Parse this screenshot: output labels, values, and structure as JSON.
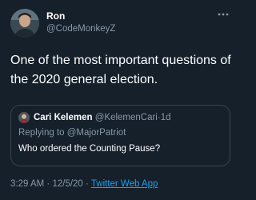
{
  "author": {
    "name": "Ron",
    "handle": "@CodeMonkeyZ"
  },
  "tweet": {
    "text": "One of the most important questions of the 2020 general election."
  },
  "quoted": {
    "name": "Cari Kelemen",
    "handle": "@KelemenCari",
    "separator": "·",
    "time": "1d",
    "reply_prefix": "Replying to ",
    "reply_to": "@MajorPatriot",
    "text": "Who ordered the Counting Pause?"
  },
  "meta": {
    "time": "3:29 AM",
    "separator": "·",
    "date": "12/5/20",
    "app": "Twitter Web App"
  },
  "colors": {
    "background": "#15202b",
    "primary_text": "#ffffff",
    "secondary_text": "#8899a6",
    "accent": "#1da1f2",
    "border": "#38444d"
  },
  "icons": {
    "author_avatar": "avatar",
    "quoted_avatar": "avatar",
    "more": "more-icon"
  }
}
